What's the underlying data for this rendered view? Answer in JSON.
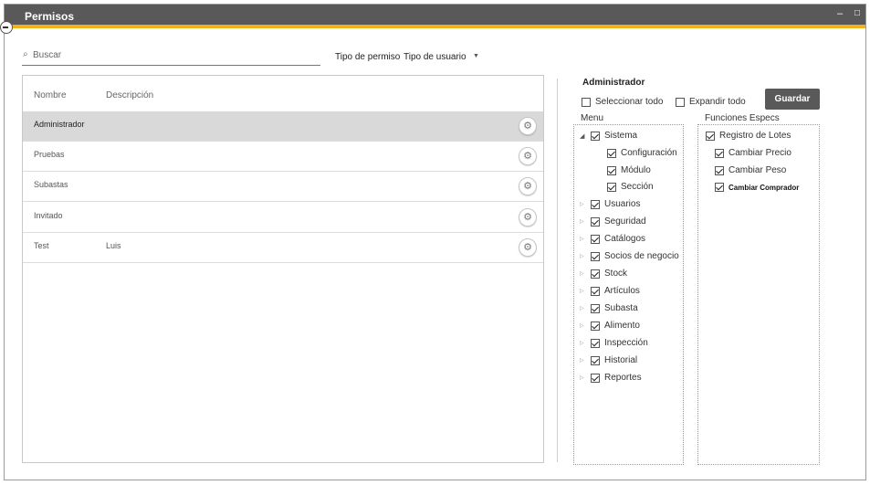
{
  "window": {
    "title": "Permisos",
    "min_glyph": "–",
    "max_glyph": "□"
  },
  "search": {
    "placeholder": "Buscar"
  },
  "tipo": {
    "label": "Tipo de permiso",
    "value": "Tipo de usuario"
  },
  "table": {
    "headers": {
      "nombre": "Nombre",
      "descripcion": "Descripción"
    },
    "rows": [
      {
        "nombre": "Administrador",
        "descripcion": "",
        "selected": true
      },
      {
        "nombre": "Pruebas",
        "descripcion": ""
      },
      {
        "nombre": "Subastas",
        "descripcion": ""
      },
      {
        "nombre": "Invitado",
        "descripcion": ""
      },
      {
        "nombre": "Test",
        "descripcion": "Luis"
      }
    ]
  },
  "panel": {
    "title": "Administrador",
    "select_all": "Seleccionar todo",
    "expand_all": "Expandir todo",
    "save": "Guardar",
    "menu_label": "Menu",
    "functions_label": "Funciones Especs"
  },
  "menu_tree": [
    {
      "label": "Sistema",
      "checked": true,
      "expanded": true,
      "level": 0
    },
    {
      "label": "Configuración",
      "checked": true,
      "level": 1
    },
    {
      "label": "Módulo",
      "checked": true,
      "level": 1
    },
    {
      "label": "Sección",
      "checked": true,
      "level": 1
    },
    {
      "label": "Usuarios",
      "checked": true,
      "level": 0
    },
    {
      "label": "Seguridad",
      "checked": true,
      "level": 0
    },
    {
      "label": "Catálogos",
      "checked": true,
      "level": 0
    },
    {
      "label": "Socios de negocio",
      "checked": true,
      "level": 0
    },
    {
      "label": "Stock",
      "checked": true,
      "level": 0
    },
    {
      "label": "Artículos",
      "checked": true,
      "level": 0
    },
    {
      "label": "Subasta",
      "checked": true,
      "level": 0
    },
    {
      "label": "Alimento",
      "checked": true,
      "level": 0
    },
    {
      "label": "Inspección",
      "checked": true,
      "level": 0
    },
    {
      "label": "Historial",
      "checked": true,
      "level": 0
    },
    {
      "label": "Reportes",
      "checked": true,
      "level": 0
    }
  ],
  "functions": [
    {
      "label": "Registro de Lotes",
      "checked": true
    },
    {
      "label": "Cambiar Precio",
      "checked": true
    },
    {
      "label": "Cambiar Peso",
      "checked": true
    },
    {
      "label": "Cambiar Comprador",
      "checked": true
    }
  ],
  "colors": {
    "titlebar": "#595959",
    "accent": "#f2b319",
    "selected_row": "#d9d9d9",
    "button": "#595959"
  }
}
